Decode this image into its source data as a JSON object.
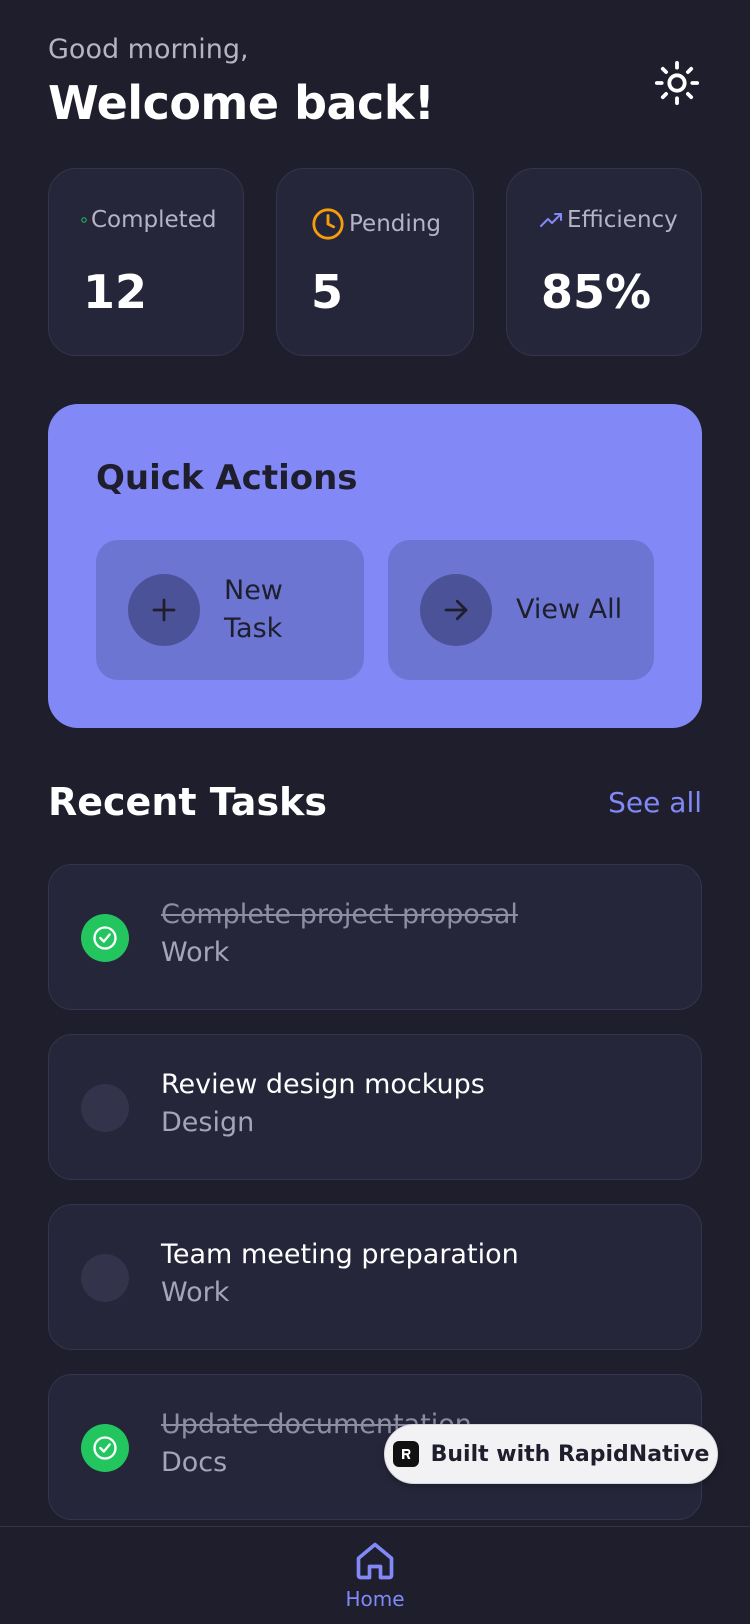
{
  "header": {
    "greeting": "Good morning,",
    "welcome": "Welcome back!",
    "theme_icon": "sun-icon"
  },
  "stats": [
    {
      "label": "Completed",
      "value": "12",
      "icon": "dot-icon",
      "icon_color": "#22c55e"
    },
    {
      "label": "Pending",
      "value": "5",
      "icon": "clock-icon",
      "icon_color": "#f59e0b"
    },
    {
      "label": "Efficiency",
      "value": "85%",
      "icon": "trending-up-icon",
      "icon_color": "#8289f6"
    }
  ],
  "quick_actions": {
    "title": "Quick Actions",
    "new_task_line1": "New",
    "new_task_line2": "Task",
    "new_task_icon": "plus-icon",
    "view_all": "View All",
    "view_all_icon": "arrow-right-icon"
  },
  "recent_tasks": {
    "title": "Recent Tasks",
    "see_all": "See all",
    "items": [
      {
        "title": "Complete project proposal",
        "category": "Work",
        "done": true
      },
      {
        "title": "Review design mockups",
        "category": "Design",
        "done": false
      },
      {
        "title": "Team meeting preparation",
        "category": "Work",
        "done": false
      },
      {
        "title": "Update documentation",
        "category": "Docs",
        "done": true
      }
    ]
  },
  "badge": {
    "text": "Built with RapidNative"
  },
  "bottom_nav": {
    "home_label": "Home",
    "home_icon": "home-icon"
  },
  "colors": {
    "background": "#1e1e2d",
    "card": "#25263a",
    "accent": "#8289f6",
    "success": "#22c55e",
    "warning": "#f59e0b"
  }
}
